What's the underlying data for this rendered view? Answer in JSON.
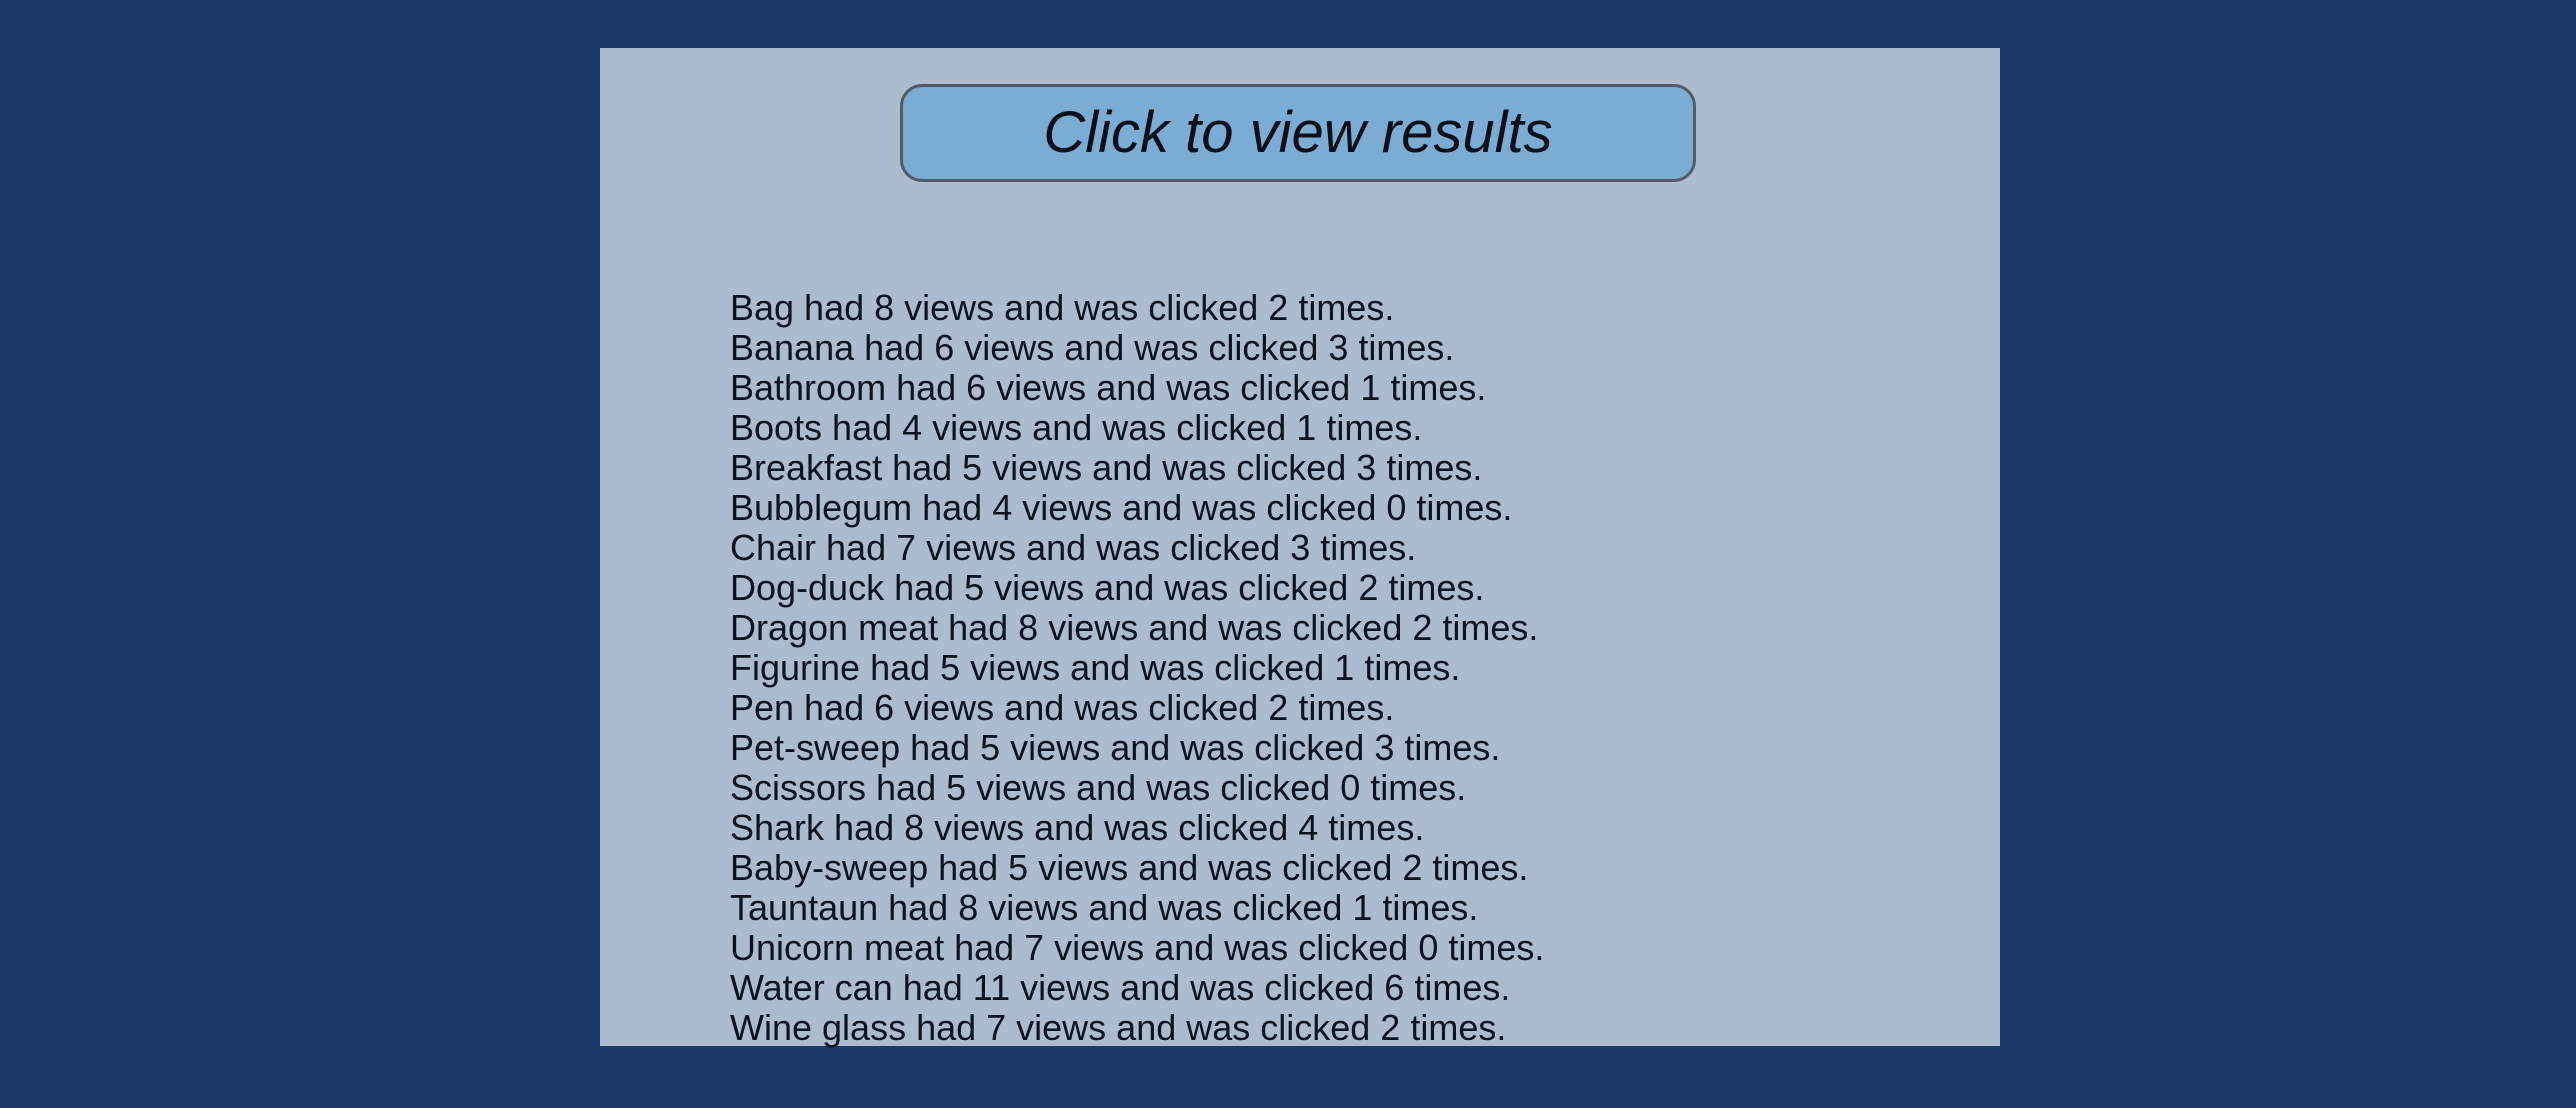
{
  "colors": {
    "page_background": "#1b3a69",
    "panel_background": "#abbcce",
    "button_background": "#7badd4",
    "button_border": "#555b66",
    "text": "#0b1220"
  },
  "button": {
    "label": "Click to view results"
  },
  "results": [
    "Bag had 8 views and was clicked 2 times.",
    "Banana had 6 views and was clicked 3 times.",
    "Bathroom had 6 views and was clicked 1 times.",
    "Boots had 4 views and was clicked 1 times.",
    "Breakfast had 5 views and was clicked 3 times.",
    "Bubblegum had 4 views and was clicked 0 times.",
    "Chair had 7 views and was clicked 3 times.",
    "Dog-duck had 5 views and was clicked 2 times.",
    "Dragon meat had 8 views and was clicked 2 times.",
    "Figurine had 5 views and was clicked 1 times.",
    "Pen had 6 views and was clicked 2 times.",
    "Pet-sweep had 5 views and was clicked 3 times.",
    "Scissors had 5 views and was clicked 0 times.",
    "Shark had 8 views and was clicked 4 times.",
    "Baby-sweep had 5 views and was clicked 2 times.",
    "Tauntaun had 8 views and was clicked 1 times.",
    "Unicorn meat had 7 views and was clicked 0 times.",
    "Water can had 11 views and was clicked 6 times.",
    "Wine glass had 7 views and was clicked 2 times."
  ]
}
